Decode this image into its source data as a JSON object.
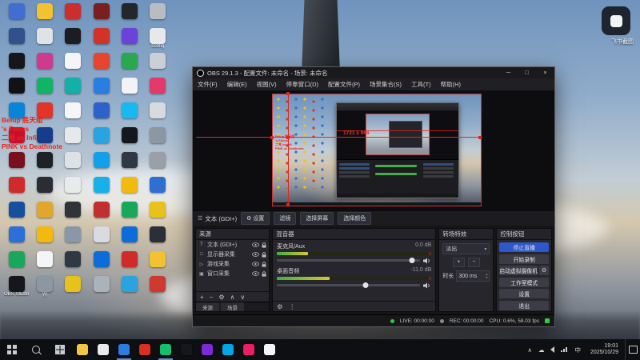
{
  "overlay_widget": {
    "label": "飞书截图"
  },
  "desktop": {
    "red_text": [
      "Belup 胜天组",
      "'s Focus",
      "二号 vs Infi",
      "PINK vs Deathnote"
    ],
    "icons": [
      {
        "c": "#3f6fd0",
        "l": ""
      },
      {
        "c": "#f2c230",
        "l": ""
      },
      {
        "c": "#cc2d2d",
        "l": ""
      },
      {
        "c": "#7a1f1f",
        "l": ""
      },
      {
        "c": "#23262b",
        "l": ""
      },
      {
        "c": "#b8bdc4",
        "l": ""
      },
      {
        "c": "#31508c",
        "l": ""
      },
      {
        "c": "#e0e3e6",
        "l": ""
      },
      {
        "c": "#1b1d22",
        "l": ""
      },
      {
        "c": "#d23228",
        "l": ""
      },
      {
        "c": "#6c43d8",
        "l": ""
      },
      {
        "c": "#e6e8ea",
        "l": "config"
      },
      {
        "c": "#15171c",
        "l": ""
      },
      {
        "c": "#cf3a8e",
        "l": ""
      },
      {
        "c": "#f4f5f6",
        "l": ""
      },
      {
        "c": "#e8452f",
        "l": ""
      },
      {
        "c": "#2aa84f",
        "l": ""
      },
      {
        "c": "#ccd0d4",
        "l": ""
      },
      {
        "c": "#101216",
        "l": ""
      },
      {
        "c": "#0fb464",
        "l": ""
      },
      {
        "c": "#12b0a6",
        "l": ""
      },
      {
        "c": "#2b7de0",
        "l": ""
      },
      {
        "c": "#f2f3f4",
        "l": ""
      },
      {
        "c": "#e23b69",
        "l": ""
      },
      {
        "c": "#0a84d8",
        "l": ""
      },
      {
        "c": "#e23428",
        "l": ""
      },
      {
        "c": "#f5f6f7",
        "l": ""
      },
      {
        "c": "#2c62c9",
        "l": ""
      },
      {
        "c": "#18b8f0",
        "l": ""
      },
      {
        "c": "#d8dadf",
        "l": ""
      },
      {
        "c": "#c8102e",
        "l": ""
      },
      {
        "c": "#173c8c",
        "l": ""
      },
      {
        "c": "#e6e8ea",
        "l": ""
      },
      {
        "c": "#2aa4e0",
        "l": ""
      },
      {
        "c": "#15171c",
        "l": ""
      },
      {
        "c": "#8c97a4",
        "l": ""
      },
      {
        "c": "#7a0f1d",
        "l": ""
      },
      {
        "c": "#1e2126",
        "l": ""
      },
      {
        "c": "#dfe2e5",
        "l": ""
      },
      {
        "c": "#12a0e8",
        "l": ""
      },
      {
        "c": "#303844",
        "l": ""
      },
      {
        "c": "#99a0a8",
        "l": ""
      },
      {
        "c": "#d02b2b",
        "l": ""
      },
      {
        "c": "#2a2d33",
        "l": ""
      },
      {
        "c": "#e8eaec",
        "l": ""
      },
      {
        "c": "#18b0e8",
        "l": ""
      },
      {
        "c": "#f2b90e",
        "l": ""
      },
      {
        "c": "#2f6fd0",
        "l": ""
      },
      {
        "c": "#15509e",
        "l": ""
      },
      {
        "c": "#e0a72c",
        "l": ""
      },
      {
        "c": "#303338",
        "l": ""
      },
      {
        "c": "#c22f2f",
        "l": ""
      },
      {
        "c": "#18a85c",
        "l": ""
      },
      {
        "c": "#e8c21a",
        "l": ""
      },
      {
        "c": "#2b70d8",
        "l": ""
      },
      {
        "c": "#f2b90e",
        "l": ""
      },
      {
        "c": "#8898a8",
        "l": ""
      },
      {
        "c": "#d8dce0",
        "l": ""
      },
      {
        "c": "#0c6dd8",
        "l": ""
      },
      {
        "c": "#2a2f38",
        "l": ""
      },
      {
        "c": "#18a85c",
        "l": ""
      },
      {
        "c": "#f4f5f6",
        "l": ""
      },
      {
        "c": "#303844",
        "l": ""
      },
      {
        "c": "#0c6dd8",
        "l": ""
      },
      {
        "c": "#d02b2b",
        "l": ""
      },
      {
        "c": "#f2c230",
        "l": ""
      },
      {
        "c": "#15171c",
        "l": "OBS Studio"
      },
      {
        "c": "#8c97a4",
        "l": "yy"
      },
      {
        "c": "#e8c21a",
        "l": ""
      },
      {
        "c": "#aab2ba",
        "l": ""
      },
      {
        "c": "#2aa4e0",
        "l": ""
      },
      {
        "c": "#cf3a2e",
        "l": ""
      }
    ]
  },
  "obs": {
    "title": "OBS 29.1.3 - 配置文件: 未命名 - 场景: 未命名",
    "window_buttons": {
      "min": "─",
      "max": "□",
      "close": "×"
    },
    "menu": [
      "文件(F)",
      "编辑(E)",
      "视图(V)",
      "停靠窗口(D)",
      "配置文件(P)",
      "场景集合(S)",
      "工具(T)",
      "帮助(H)"
    ],
    "preview": {
      "size_label": "1721 x 968"
    },
    "context_bar": {
      "source": "文本 (GDI+)",
      "burger": "☰",
      "buttons": [
        "设置",
        "滤镜",
        "选择屏幕",
        "选择颜色"
      ]
    },
    "sources": {
      "title": "来源",
      "items": [
        {
          "label": "文本 (GDI+)",
          "glyph": "T"
        },
        {
          "label": "显示器采集",
          "glyph": "□"
        },
        {
          "label": "游戏采集",
          "glyph": "▷"
        },
        {
          "label": "窗口采集",
          "glyph": "▣"
        }
      ],
      "toolbar": [
        "+",
        "−",
        "⚙",
        "∧",
        "∨"
      ],
      "tabs": [
        "来源",
        "场景"
      ]
    },
    "mixer": {
      "title": "混音器",
      "channels": [
        {
          "name": "麦克风/Aux",
          "db": "0.0 dB",
          "meter": "20%",
          "knob": "94%"
        },
        {
          "name": "桌面音频",
          "db": "-11.0 dB",
          "meter": "34%",
          "knob": "62%"
        }
      ],
      "footer": [
        "⚙",
        "⋮"
      ]
    },
    "transitions": {
      "title": "转场特效",
      "value": "淡出",
      "arrow": "▾",
      "duration_label": "时长",
      "duration": "300 ms",
      "up": "▴",
      "down": "▾",
      "add": "+",
      "remove": "−"
    },
    "controls": {
      "title": "控制按钮",
      "vcam_gear": "⚙",
      "buttons": [
        "停止直播",
        "开始录制",
        "启动虚拟摄像机",
        "工作室模式",
        "设置",
        "退出"
      ]
    },
    "status": {
      "live": "LIVE: 00:00:00",
      "rec": "REC: 00:00:00",
      "cpu": "CPU: 0.6%, 58.03 fps"
    }
  },
  "taskbar": {
    "apps": [
      {
        "c": "#f2c843"
      },
      {
        "c": "#e8eaed"
      },
      {
        "c": "#2b7de0"
      },
      {
        "c": "#d93025"
      },
      {
        "c": "#15bf6e"
      },
      {
        "c": "#15171c"
      },
      {
        "c": "#7b2bd8"
      },
      {
        "c": "#00a8e8"
      },
      {
        "c": "#e91e63"
      },
      {
        "c": "#f4f5f6"
      }
    ],
    "tray": {
      "chevron": "∧",
      "cloud": "☁",
      "ime": "中"
    },
    "time": "19:01",
    "date": "2025/10/29"
  }
}
